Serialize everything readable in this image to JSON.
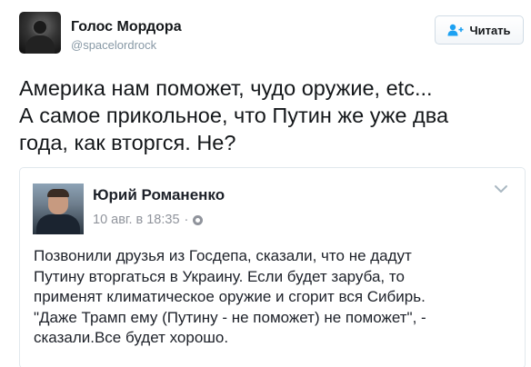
{
  "tweet": {
    "author": {
      "display_name": "Голос Мордора",
      "handle": "@spacelordrock",
      "avatar_icon": "avatar-photo"
    },
    "follow_button": {
      "label": "Читать",
      "icon": "follow-person-icon",
      "accent_color": "#1da1f2"
    },
    "text_lines": [
      "Америка нам поможет, чудо оружие, etc...",
      "А самое прикольное, что Путин же уже два",
      "года, как вторгся. Не?"
    ]
  },
  "quoted_post": {
    "author_name": "Юрий Романенко",
    "date": "10 авг. в 18:35",
    "separator": "·",
    "privacy_icon": "globe-icon",
    "menu_icon": "chevron-down-icon",
    "text_lines": [
      "Позвонили друзья из Госдепа, сказали, что не дадут",
      "Путину вторгаться в Украину. Если будет заруба, то",
      "применят климатическое оружие и сгорит вся Сибирь.",
      "\"Даже Трамп ему (Путину - не поможет) не поможет\", -",
      "сказали.Все будет хорошо."
    ]
  }
}
